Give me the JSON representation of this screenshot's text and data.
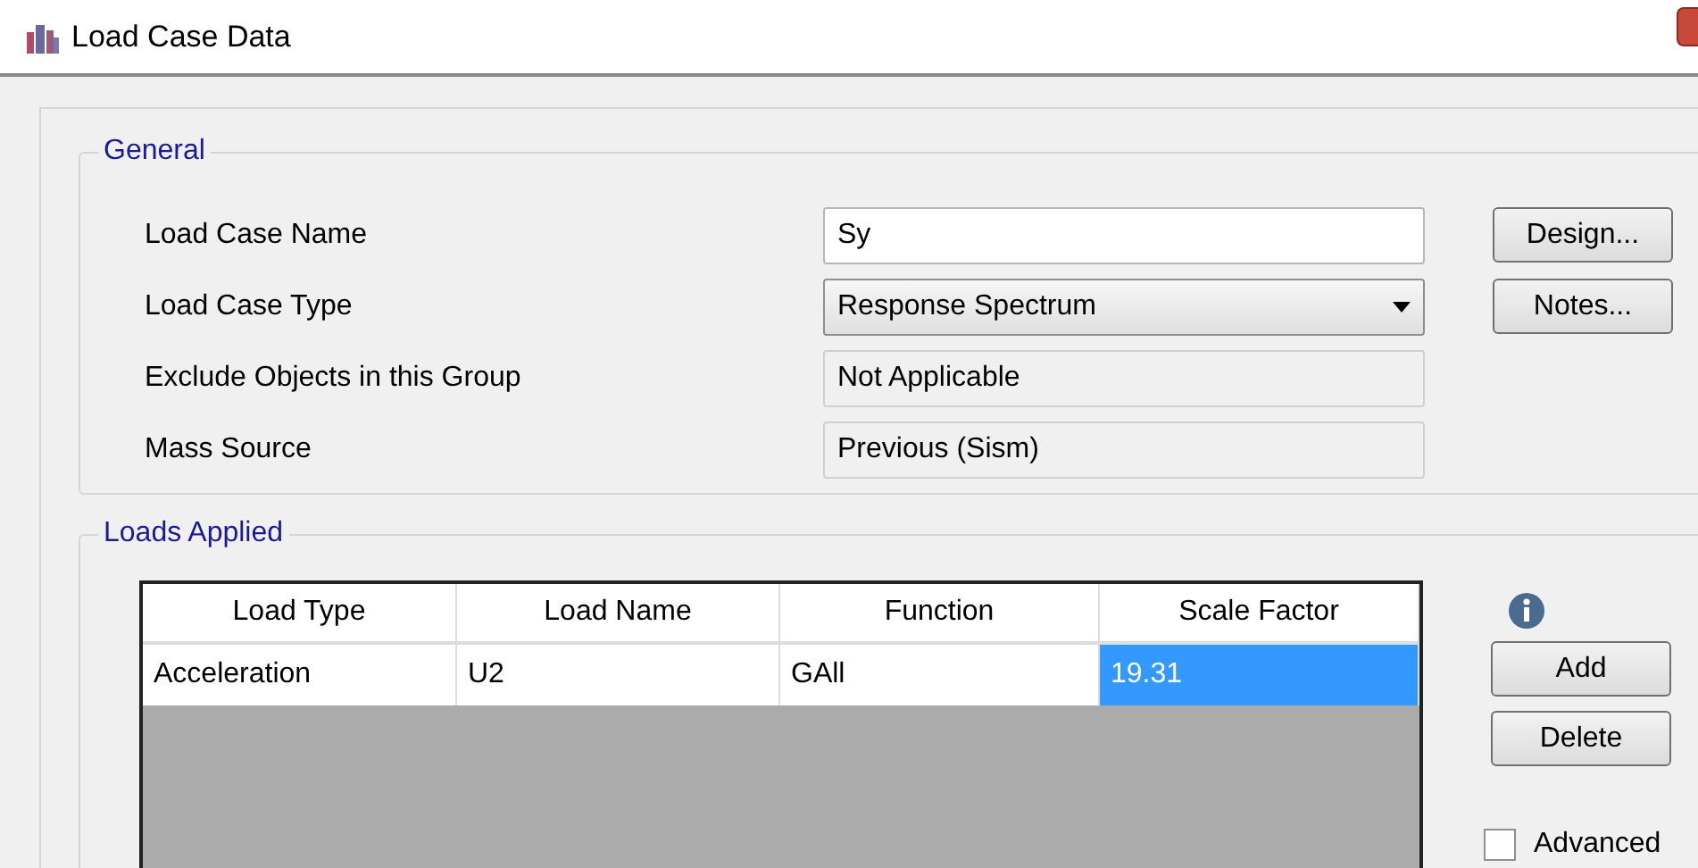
{
  "window": {
    "title": "Load Case Data"
  },
  "general": {
    "title": "General",
    "fields": [
      {
        "label": "Load Case Name",
        "kind": "text",
        "value": "Sy"
      },
      {
        "label": "Load Case Type",
        "kind": "dropdown",
        "value": "Response Spectrum"
      },
      {
        "label": "Exclude Objects in this Group",
        "kind": "readonly",
        "value": "Not Applicable"
      },
      {
        "label": "Mass Source",
        "kind": "readonly",
        "value": "Previous  (Sism)"
      }
    ],
    "buttons": [
      "Design...",
      "Notes..."
    ]
  },
  "loads_applied": {
    "title": "Loads Applied",
    "table": {
      "columns": [
        "Load Type",
        "Load Name",
        "Function",
        "Scale Factor"
      ],
      "rows": [
        {
          "cells": [
            {
              "text": "Acceleration",
              "selected": false
            },
            {
              "text": "U2",
              "selected": false
            },
            {
              "text": "GAll",
              "selected": false
            },
            {
              "text": "19.31",
              "selected": true
            }
          ]
        }
      ]
    },
    "buttons": [
      "Add",
      "Delete"
    ],
    "advanced": {
      "label": "Advanced",
      "checked": false
    }
  }
}
